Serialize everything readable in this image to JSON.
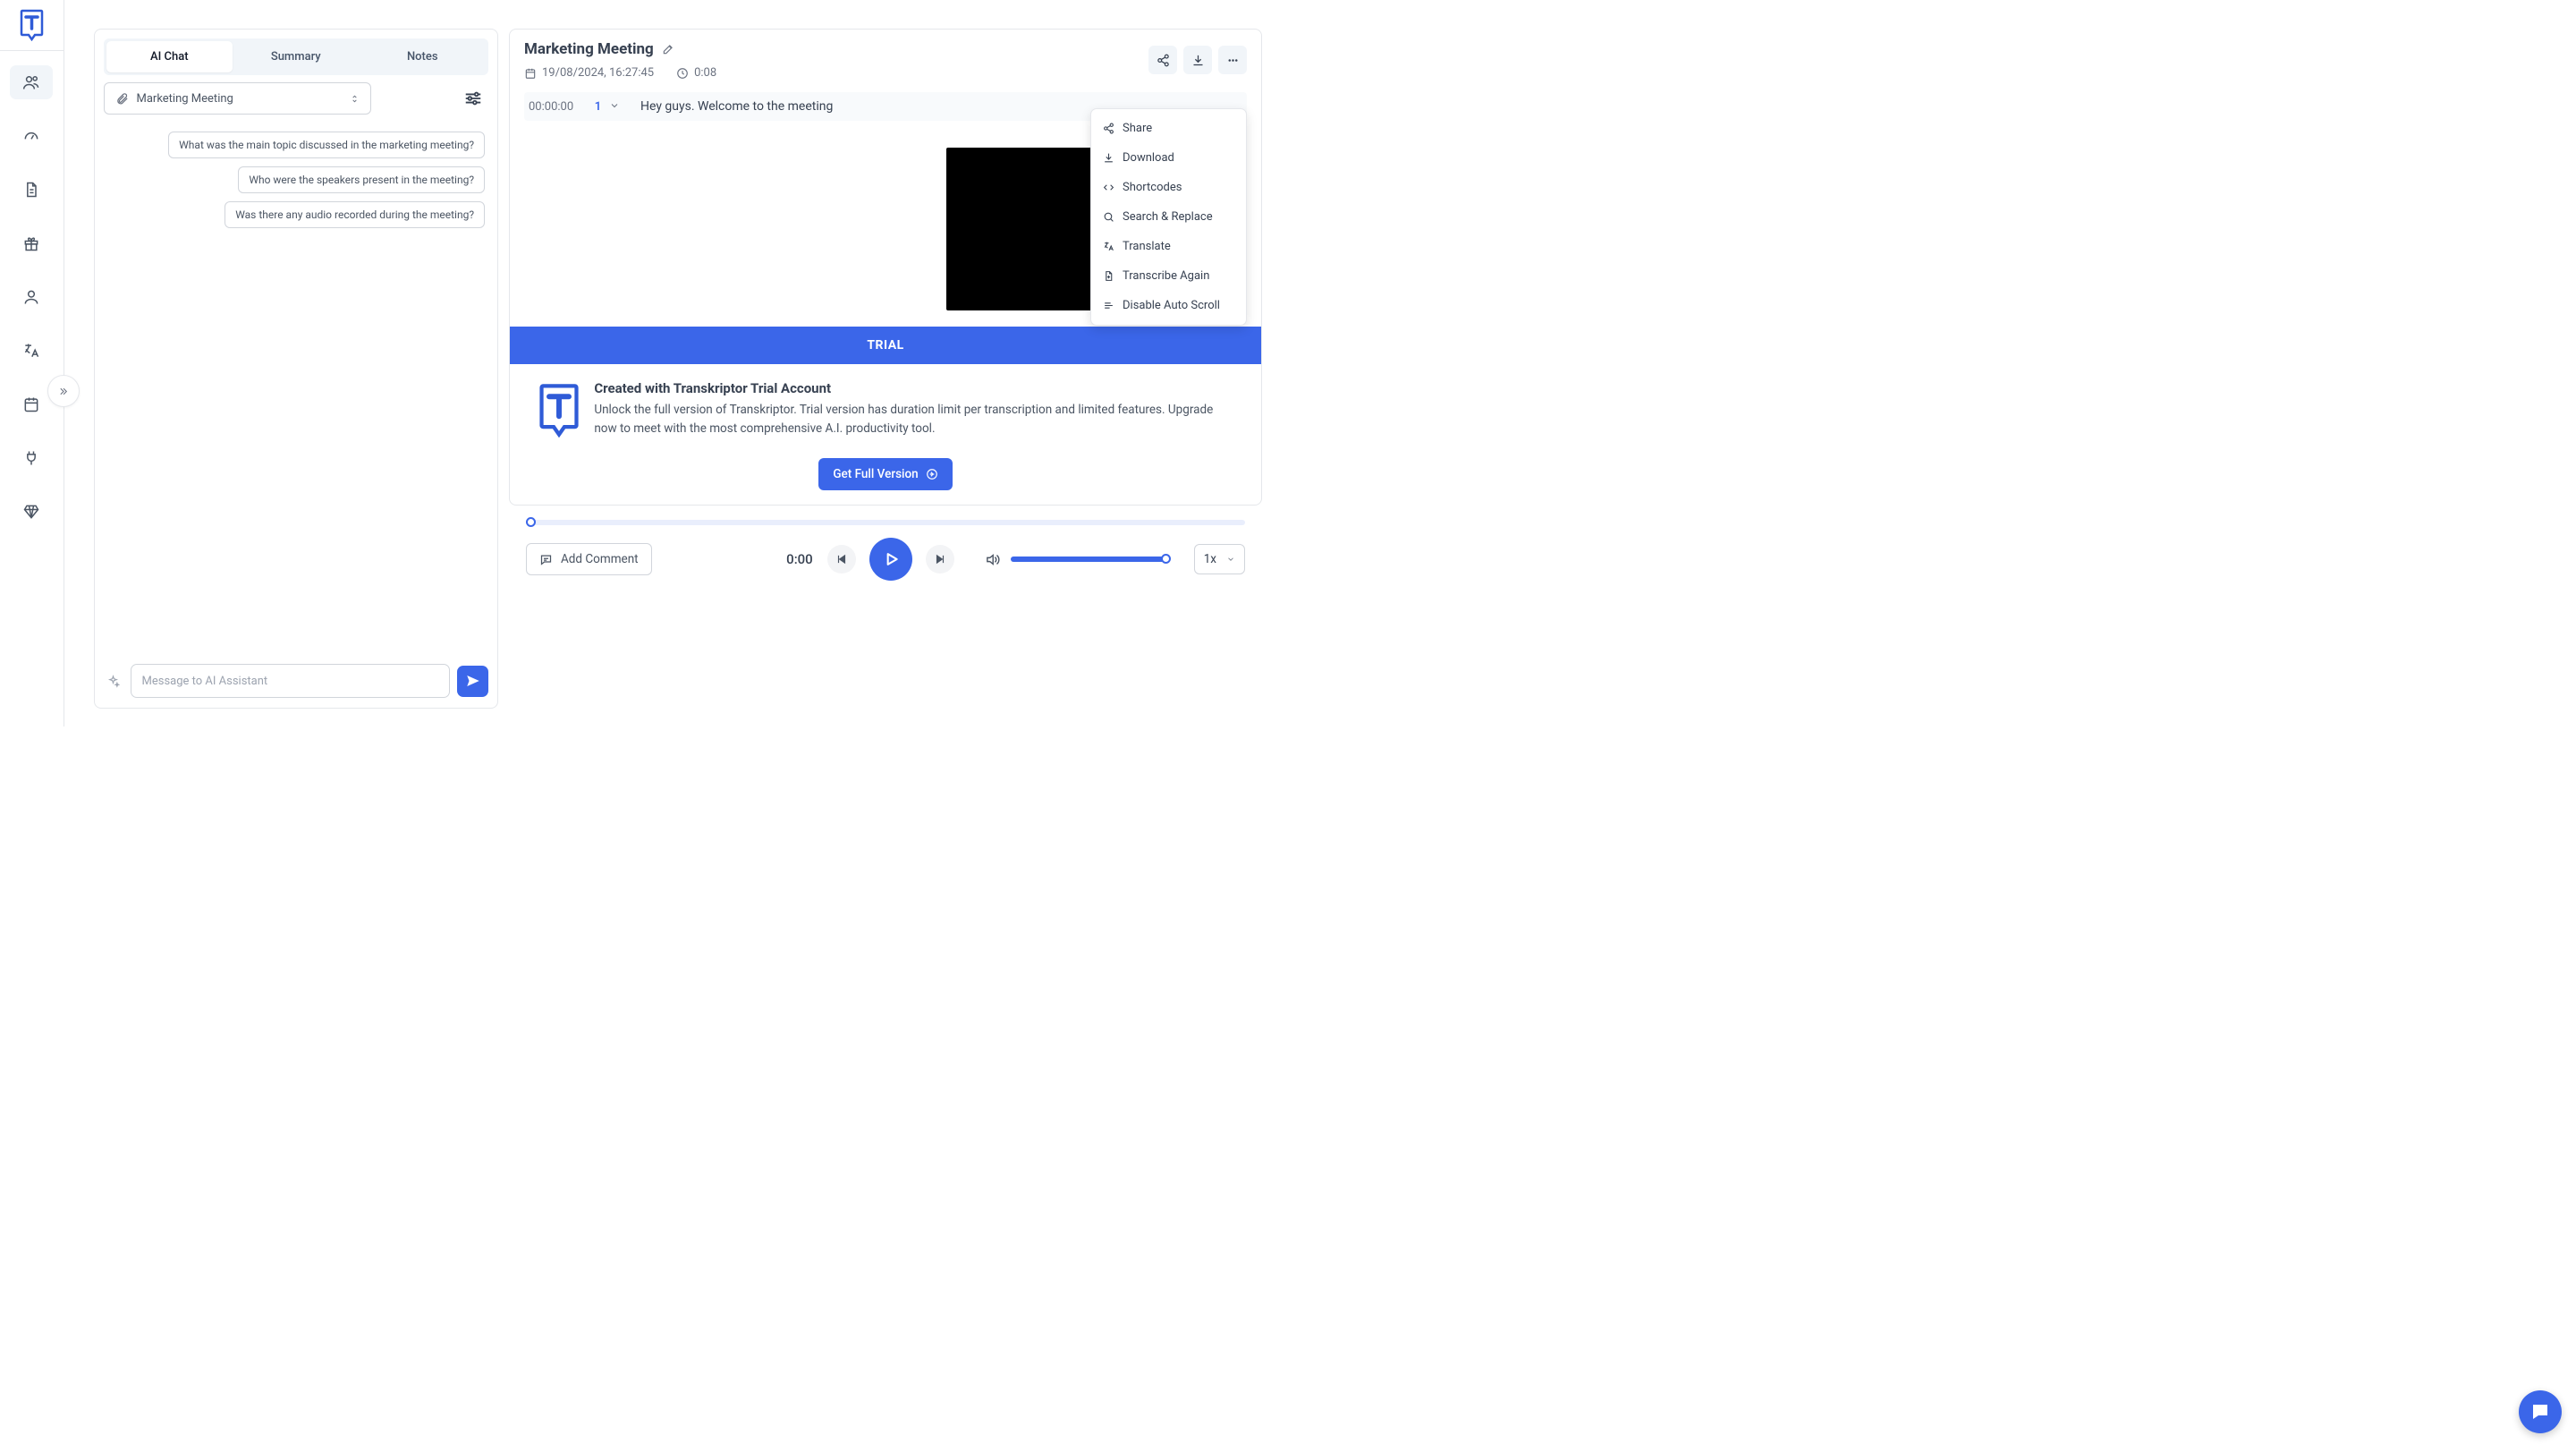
{
  "tabs": {
    "chat": "AI Chat",
    "summary": "Summary",
    "notes": "Notes"
  },
  "attachment": {
    "label": "Marketing Meeting"
  },
  "suggestions": [
    "What was the main topic discussed in the marketing meeting?",
    "Who were the speakers present in the meeting?",
    "Was there any audio recorded during the meeting?"
  ],
  "chat_input": {
    "placeholder": "Message to AI Assistant"
  },
  "detail": {
    "title": "Marketing Meeting",
    "date": "19/08/2024, 16:27:45",
    "duration": "0:08"
  },
  "dropdown": {
    "share": "Share",
    "download": "Download",
    "shortcodes": "Shortcodes",
    "search_replace": "Search & Replace",
    "translate": "Translate",
    "transcribe_again": "Transcribe Again",
    "disable_auto_scroll": "Disable Auto Scroll"
  },
  "transcript": {
    "timestamp": "00:00:00",
    "speaker": "1",
    "text": "Hey guys. Welcome to the meeting"
  },
  "trial": {
    "badge": "TRIAL",
    "heading": "Created with Transkriptor Trial Account",
    "body": "Unlock the full version of Transkriptor. Trial version has duration limit per transcription and limited features. Upgrade now to meet with the most comprehensive A.I. productivity tool.",
    "cta": "Get Full Version"
  },
  "player": {
    "add_comment": "Add Comment",
    "time": "0:00",
    "speed": "1x"
  },
  "colors": {
    "primary": "#3b66e9"
  }
}
